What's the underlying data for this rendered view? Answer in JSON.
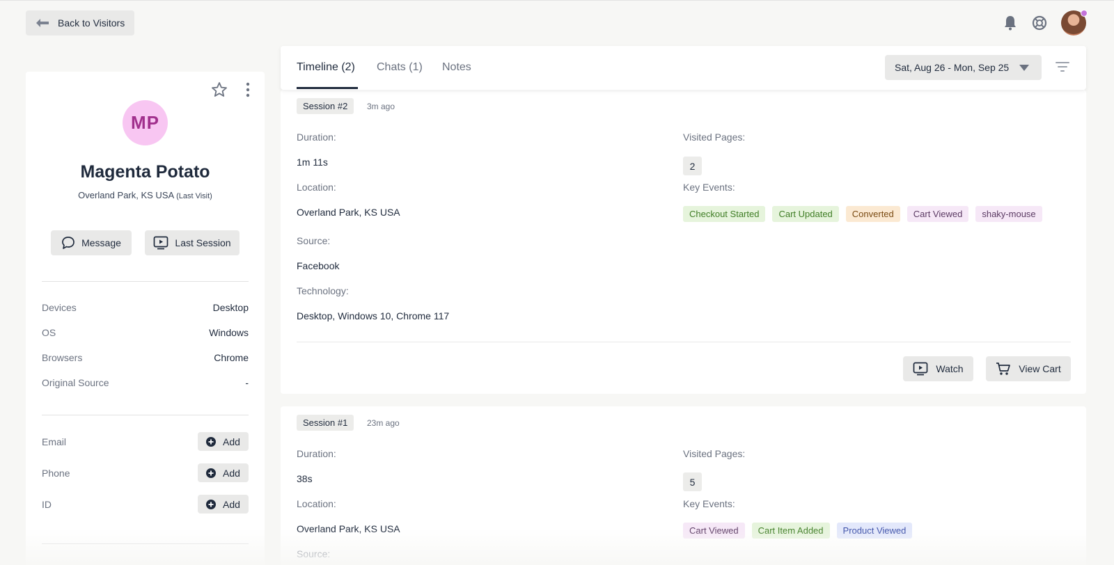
{
  "header": {
    "back_label": "Back to Visitors"
  },
  "profile": {
    "initials": "MP",
    "name": "Magenta Potato",
    "location": "Overland Park, KS USA",
    "location_note": "(Last Visit)",
    "message_label": "Message",
    "last_session_label": "Last Session",
    "avatar_bg": "#f8c6f2",
    "avatar_fg": "#a1308d",
    "details": [
      {
        "key": "Devices",
        "value": "Desktop"
      },
      {
        "key": "OS",
        "value": "Windows"
      },
      {
        "key": "Browsers",
        "value": "Chrome"
      },
      {
        "key": "Original Source",
        "value": "-"
      }
    ],
    "contacts": [
      {
        "key": "Email",
        "button": "Add"
      },
      {
        "key": "Phone",
        "button": "Add"
      },
      {
        "key": "ID",
        "button": "Add"
      }
    ]
  },
  "tabs": [
    {
      "label": "Timeline (2)",
      "active": true
    },
    {
      "label": "Chats (1)",
      "active": false
    },
    {
      "label": "Notes",
      "active": false
    }
  ],
  "date_range": "Sat, Aug 26 - Mon, Sep 25",
  "labels": {
    "duration": "Duration:",
    "location": "Location:",
    "source": "Source:",
    "technology": "Technology:",
    "visited_pages": "Visited Pages:",
    "key_events": "Key Events:",
    "watch": "Watch",
    "view_cart": "View Cart"
  },
  "sessions": [
    {
      "badge": "Session #2",
      "ago": "3m ago",
      "duration": "1m 11s",
      "location": "Overland Park, KS USA",
      "source": "Facebook",
      "technology": "Desktop, Windows 10, Chrome 117",
      "visited_pages": "2",
      "key_events": [
        {
          "label": "Checkout Started",
          "bg": "#e6f4dc",
          "fg": "#3f7d25"
        },
        {
          "label": "Cart Updated",
          "bg": "#e6f4dc",
          "fg": "#3f7d25"
        },
        {
          "label": "Converted",
          "bg": "#fbe9d2",
          "fg": "#7a4a12"
        },
        {
          "label": "Cart Viewed",
          "bg": "#f6e8f7",
          "fg": "#5b3a63"
        },
        {
          "label": "shaky-mouse",
          "bg": "#f6e8f7",
          "fg": "#5b3a63"
        }
      ]
    },
    {
      "badge": "Session #1",
      "ago": "23m ago",
      "duration": "38s",
      "location": "Overland Park, KS USA",
      "source": "Source:",
      "visited_pages": "5",
      "key_events": [
        {
          "label": "Cart Viewed",
          "bg": "#f6e8f7",
          "fg": "#5b3a63"
        },
        {
          "label": "Cart Item Added",
          "bg": "#e6f4dc",
          "fg": "#3f7d25"
        },
        {
          "label": "Product Viewed",
          "bg": "#e3e8fb",
          "fg": "#3b4fa8"
        }
      ]
    }
  ]
}
